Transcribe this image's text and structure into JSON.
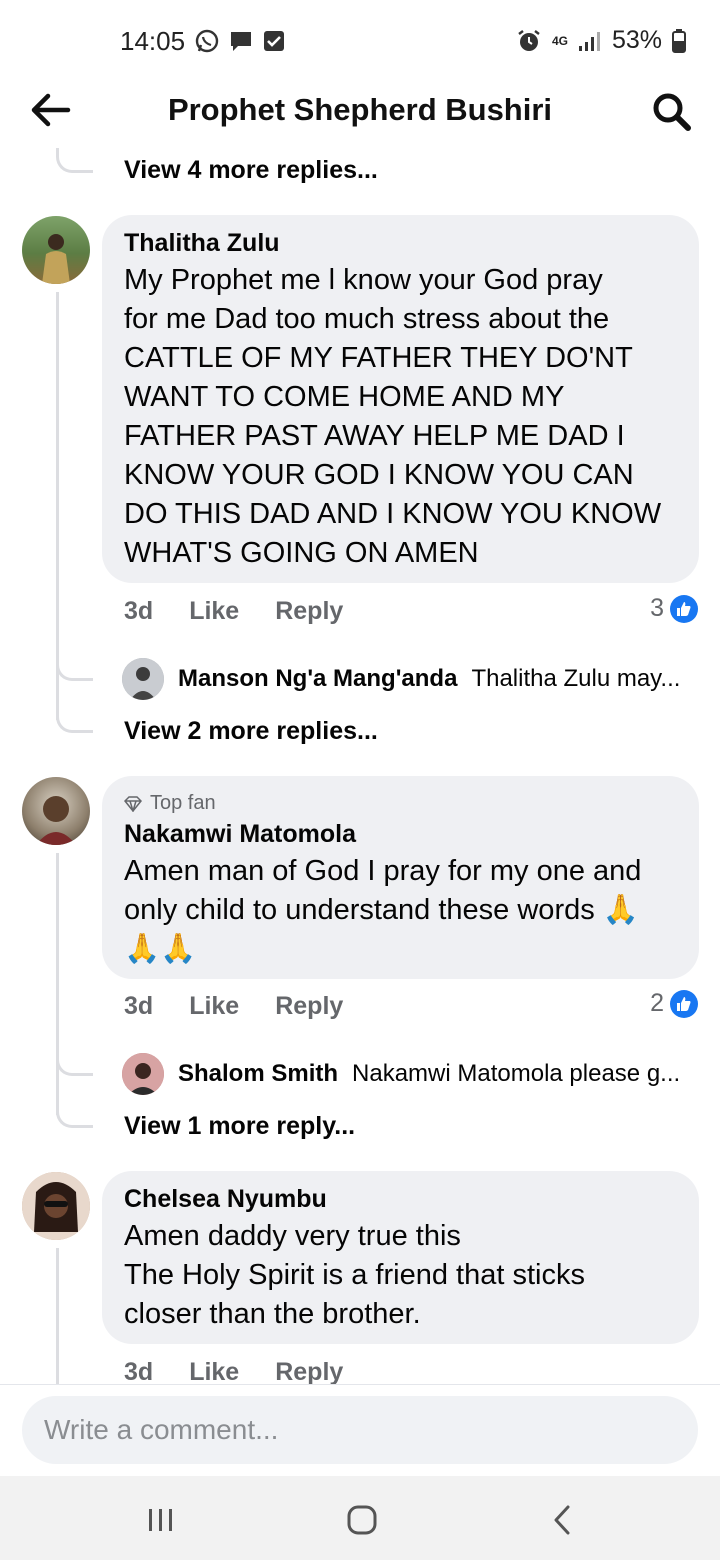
{
  "status_bar": {
    "time": "14:05",
    "battery": "53%",
    "network": "4G"
  },
  "header": {
    "title": "Prophet Shepherd Bushiri"
  },
  "top_view_more": "View 4 more replies...",
  "comments": [
    {
      "name": "Thalitha Zulu",
      "text": "My Prophet me l know your God pray\nfor me Dad  too much stress about the\nCATTLE OF MY  FATHER  THEY  DO'NT\nWANT  TO COME HOME AND MY\nFATHER PAST AWAY  HELP ME DAD I\nKNOW YOUR GOD  I KNOW YOU CAN\nDO THIS  DAD AND I KNOW YOU KNOW\nWHAT'S GOING ON  AMEN",
      "time": "3d",
      "like": "Like",
      "reply": "Reply",
      "likes": "3",
      "reply_preview": {
        "name": "Manson Ng'a Mang'anda",
        "text": "Thalitha Zulu may..."
      },
      "view_more": "View 2 more replies..."
    },
    {
      "badge": "Top fan",
      "name": "Nakamwi Matomola",
      "text": "Amen man of God I pray for my one and\nonly child to understand these words 🙏\n🙏🙏",
      "time": "3d",
      "like": "Like",
      "reply": "Reply",
      "likes": "2",
      "reply_preview": {
        "name": "Shalom Smith",
        "text": "Nakamwi Matomola please g..."
      },
      "view_more": "View 1 more reply..."
    },
    {
      "name": "Chelsea Nyumbu",
      "text": "Amen daddy very true this\nThe Holy Spirit is a friend that sticks\ncloser than the brother.",
      "time": "3d",
      "like": "Like",
      "reply": "Reply"
    }
  ],
  "composer": {
    "placeholder": "Write a comment..."
  },
  "icons": {
    "back": "arrow-left-icon",
    "search": "search-icon",
    "like": "thumbs-up-icon",
    "top_fan": "diamond-icon",
    "nav_recents": "recents-icon",
    "nav_home": "home-icon",
    "nav_back": "nav-back-icon"
  },
  "colors": {
    "like_blue": "#1877f2",
    "bubble": "#eff0f3",
    "muted": "#65676b"
  }
}
